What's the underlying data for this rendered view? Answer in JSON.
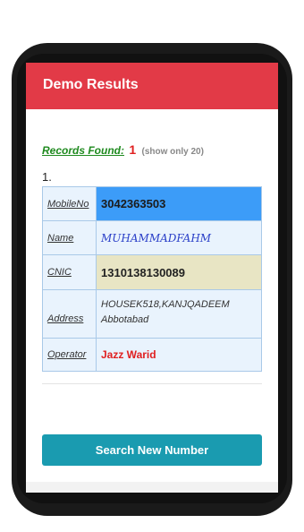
{
  "appbar": {
    "title": "Demo Results"
  },
  "records": {
    "label": "Records Found:",
    "count": "1",
    "note": "(show only 20)"
  },
  "result": {
    "index": "1.",
    "rows": [
      {
        "label": "MobileNo",
        "value": "3042363503"
      },
      {
        "label": "Name",
        "value": "MUHAMMADFAHM"
      },
      {
        "label": "CNIC",
        "value": "1310138130089"
      },
      {
        "label": "Address",
        "value": "HOUSEK518,KANJQADEEM Abbotabad"
      },
      {
        "label": "Operator",
        "value": "Jazz Warid"
      }
    ]
  },
  "actions": {
    "search_label": "Search New Number"
  },
  "colors": {
    "appbar": "#e23a47",
    "mobile_highlight": "#3c9cf8",
    "cnic_highlight": "#e8e5c4",
    "button": "#1a9bb0",
    "operator_text": "#e02020",
    "records_label": "#1f8a1f"
  }
}
